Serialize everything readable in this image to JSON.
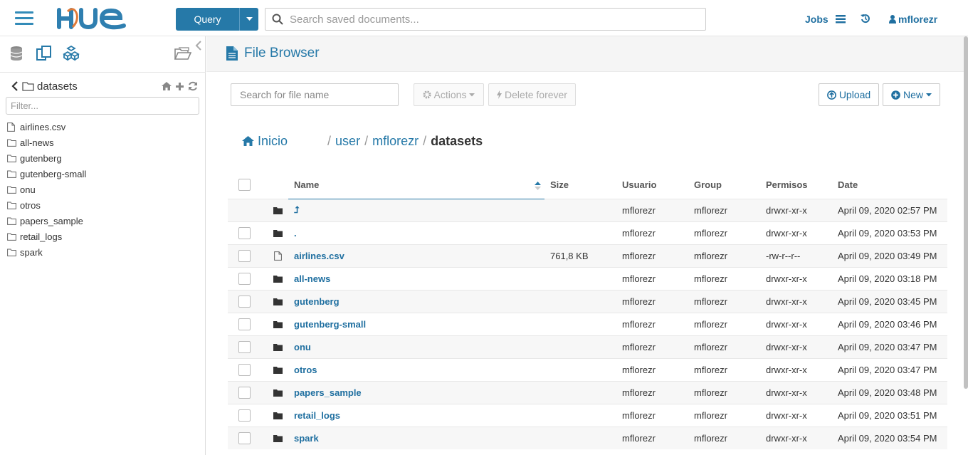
{
  "topbar": {
    "query_label": "Query",
    "search_placeholder": "Search saved documents...",
    "jobs_label": "Jobs",
    "username": "mflorezr"
  },
  "sidebar": {
    "current_folder": "datasets",
    "filter_placeholder": "Filter...",
    "items": [
      {
        "name": "airlines.csv",
        "icon": "file-icon"
      },
      {
        "name": "all-news",
        "icon": "folder-icon"
      },
      {
        "name": "gutenberg",
        "icon": "folder-icon"
      },
      {
        "name": "gutenberg-small",
        "icon": "folder-icon"
      },
      {
        "name": "onu",
        "icon": "folder-icon"
      },
      {
        "name": "otros",
        "icon": "folder-icon"
      },
      {
        "name": "papers_sample",
        "icon": "folder-icon"
      },
      {
        "name": "retail_logs",
        "icon": "folder-icon"
      },
      {
        "name": "spark",
        "icon": "folder-icon"
      }
    ]
  },
  "main": {
    "title": "File Browser",
    "search_placeholder": "Search for file name",
    "actions_label": "Actions",
    "delete_label": "Delete forever",
    "upload_label": "Upload",
    "new_label": "New",
    "breadcrumb": {
      "home": "Inicio",
      "parts": [
        "user",
        "mflorezr"
      ],
      "current": "datasets",
      "separator": "/"
    },
    "table": {
      "headers": {
        "name": "Name",
        "size": "Size",
        "user": "Usuario",
        "group": "Group",
        "permissions": "Permisos",
        "date": "Date"
      },
      "rows": [
        {
          "name": "⮥",
          "type": "folder",
          "size": "",
          "user": "mflorezr",
          "group": "mflorezr",
          "perms": "drwxr-xr-x",
          "date": "April 09, 2020 02:57 PM",
          "checkbox": false
        },
        {
          "name": ".",
          "type": "folder",
          "size": "",
          "user": "mflorezr",
          "group": "mflorezr",
          "perms": "drwxr-xr-x",
          "date": "April 09, 2020 03:53 PM",
          "checkbox": true
        },
        {
          "name": "airlines.csv",
          "type": "file",
          "size": "761,8 KB",
          "user": "mflorezr",
          "group": "mflorezr",
          "perms": "-rw-r--r--",
          "date": "April 09, 2020 03:49 PM",
          "checkbox": true
        },
        {
          "name": "all-news",
          "type": "folder",
          "size": "",
          "user": "mflorezr",
          "group": "mflorezr",
          "perms": "drwxr-xr-x",
          "date": "April 09, 2020 03:18 PM",
          "checkbox": true
        },
        {
          "name": "gutenberg",
          "type": "folder",
          "size": "",
          "user": "mflorezr",
          "group": "mflorezr",
          "perms": "drwxr-xr-x",
          "date": "April 09, 2020 03:45 PM",
          "checkbox": true
        },
        {
          "name": "gutenberg-small",
          "type": "folder",
          "size": "",
          "user": "mflorezr",
          "group": "mflorezr",
          "perms": "drwxr-xr-x",
          "date": "April 09, 2020 03:46 PM",
          "checkbox": true
        },
        {
          "name": "onu",
          "type": "folder",
          "size": "",
          "user": "mflorezr",
          "group": "mflorezr",
          "perms": "drwxr-xr-x",
          "date": "April 09, 2020 03:47 PM",
          "checkbox": true
        },
        {
          "name": "otros",
          "type": "folder",
          "size": "",
          "user": "mflorezr",
          "group": "mflorezr",
          "perms": "drwxr-xr-x",
          "date": "April 09, 2020 03:47 PM",
          "checkbox": true
        },
        {
          "name": "papers_sample",
          "type": "folder",
          "size": "",
          "user": "mflorezr",
          "group": "mflorezr",
          "perms": "drwxr-xr-x",
          "date": "April 09, 2020 03:48 PM",
          "checkbox": true
        },
        {
          "name": "retail_logs",
          "type": "folder",
          "size": "",
          "user": "mflorezr",
          "group": "mflorezr",
          "perms": "drwxr-xr-x",
          "date": "April 09, 2020 03:51 PM",
          "checkbox": true
        },
        {
          "name": "spark",
          "type": "folder",
          "size": "",
          "user": "mflorezr",
          "group": "mflorezr",
          "perms": "drwxr-xr-x",
          "date": "April 09, 2020 03:54 PM",
          "checkbox": true
        }
      ]
    }
  },
  "colors": {
    "accent": "#2679a8",
    "link": "#1f6fa0"
  }
}
